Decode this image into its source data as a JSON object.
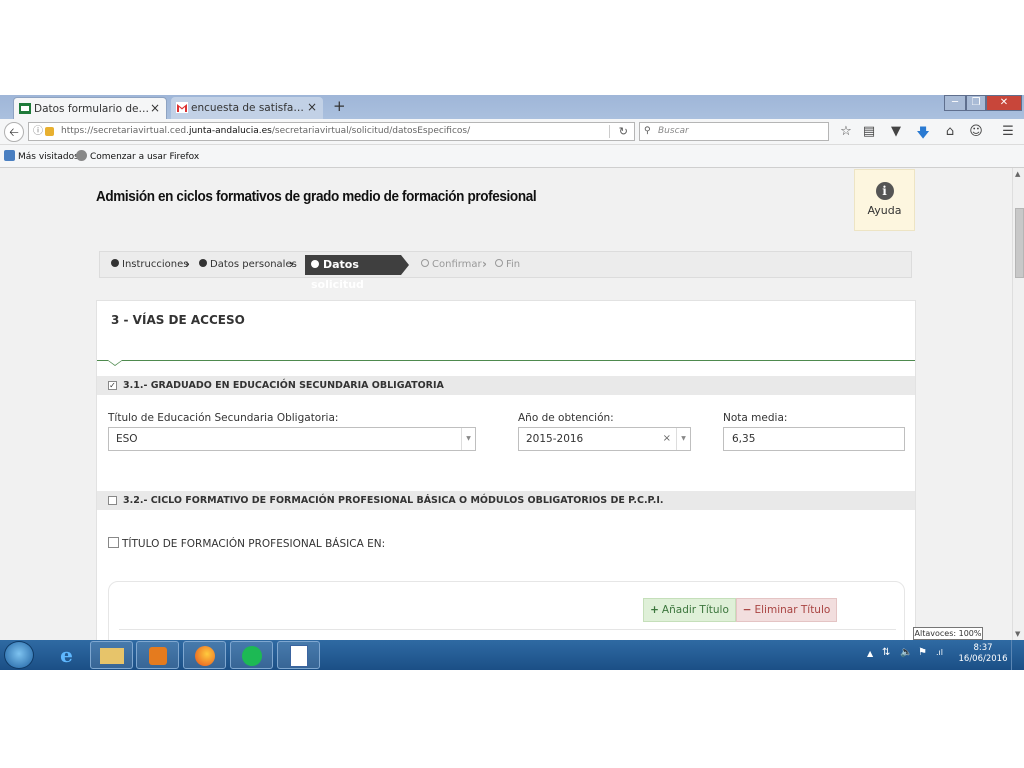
{
  "browser": {
    "tabs": [
      {
        "label": "Datos formulario de la soli...",
        "active": true,
        "icon": "junta-andalucia-icon"
      },
      {
        "label": "encuesta de satisfacción d...",
        "active": false,
        "icon": "gmail-icon"
      }
    ],
    "new_tab_label": "+",
    "close_glyph": "×",
    "url_prefix": "https://secretariavirtual.ced.",
    "url_domain": "junta-andalucia.es",
    "url_suffix": "/secretariavirtual/solicitud/datosEspecificos/",
    "search_placeholder": "Buscar",
    "bookmarks": [
      "Más visitados",
      "Comenzar a usar Firefox"
    ]
  },
  "page": {
    "title": "Admisión en ciclos formativos de grado medio de formación profesional",
    "help_label": "Ayuda",
    "steps": {
      "s1": "Instrucciones",
      "s2": "Datos personales",
      "s3": "Datos solicitud",
      "s4": "Confirmar",
      "s5": "Fin"
    },
    "section_title": "3 - VÍAS DE ACCESO",
    "sub1": {
      "checked": true,
      "label": "3.1.- GRADUADO EN EDUCACIÓN SECUNDARIA OBLIGATORIA",
      "titulo_label": "Título de Educación Secundaria Obligatoria:",
      "titulo_value": "ESO",
      "anio_label": "Año de obtención:",
      "anio_value": "2015-2016",
      "nota_label": "Nota media:",
      "nota_value": "6,35"
    },
    "sub2": {
      "checked": false,
      "label": "3.2.- CICLO FORMATIVO DE FORMACIÓN PROFESIONAL BÁSICA O MÓDULOS OBLIGATORIOS DE P.C.P.I.",
      "fpb_label": "TÍTULO DE FORMACIÓN PROFESIONAL BÁSICA EN:",
      "add_label": "Añadir Título",
      "del_label": "Eliminar Título"
    }
  },
  "tooltip": "Altavoces: 100%",
  "taskbar": {
    "apps": [
      "windows-explorer",
      "internet-explorer",
      "file-explorer",
      "media-player",
      "firefox",
      "spotify",
      "document-viewer"
    ],
    "time": "8:37",
    "date": "16/06/2016"
  },
  "colors": {
    "accent_green": "#4e8a4e",
    "active_step_bg": "#3f3f3f",
    "add_btn": "#dff0d8",
    "del_btn": "#f2dede",
    "help_bg": "#fdf6df"
  }
}
